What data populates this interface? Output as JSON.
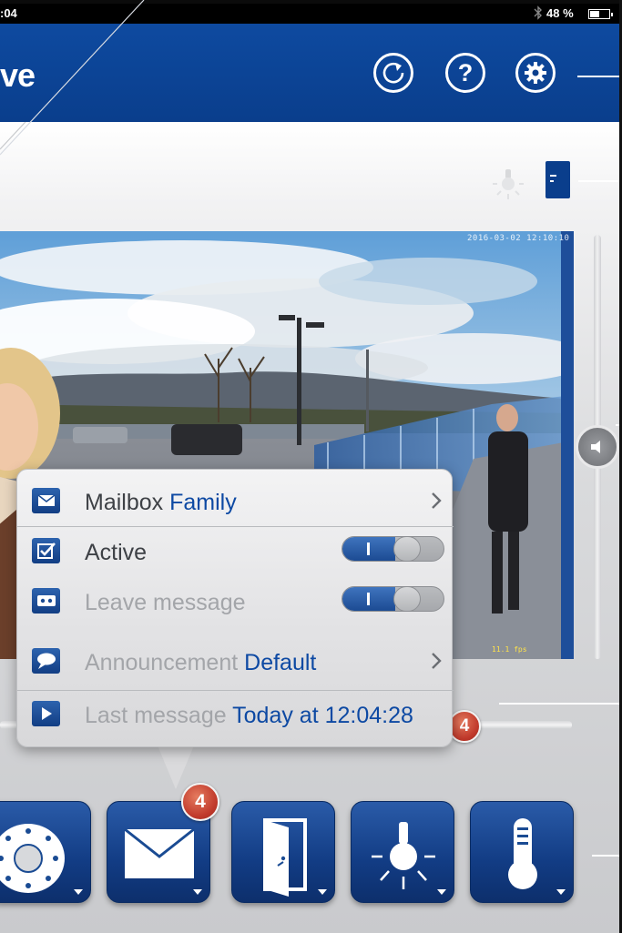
{
  "status_bar": {
    "time": ":04",
    "battery_text": "48 %",
    "battery_level_percent": 48
  },
  "header": {
    "brand_fragment": "ve",
    "buttons": [
      {
        "id": "refresh",
        "icon": "refresh-icon"
      },
      {
        "id": "help",
        "icon": "help-icon",
        "glyph": "?"
      },
      {
        "id": "settings",
        "icon": "gear-icon"
      }
    ],
    "color": "#0a3e8c"
  },
  "camera": {
    "timestamp": "2016-03-02 12:10:10",
    "overlay": "11.1 fps"
  },
  "mailbox_popup": {
    "rows": [
      {
        "label": "Mailbox",
        "value": "Family",
        "icon": "mail-icon",
        "chevron": true
      },
      {
        "label": "Active",
        "icon": "checkbox-icon",
        "toggle_on": true
      },
      {
        "label": "Leave message",
        "icon": "voicemail-icon",
        "toggle_on": true
      },
      {
        "label": "Announcement",
        "value": "Default",
        "icon": "speech-bubble-icon",
        "chevron": true
      },
      {
        "label": "Last message",
        "value": "Today at 12:04:28",
        "icon": "play-icon"
      }
    ]
  },
  "message_count": "4",
  "slider_badge": "4",
  "bottom_buttons": [
    {
      "id": "camera",
      "icon": "dome-camera-icon"
    },
    {
      "id": "mailbox",
      "icon": "envelope-icon",
      "badge": "4"
    },
    {
      "id": "door",
      "icon": "door-icon"
    },
    {
      "id": "light",
      "icon": "light-bulb-icon"
    },
    {
      "id": "temperature",
      "icon": "thermometer-icon"
    }
  ],
  "colors": {
    "accent_blue": "#0d49a3",
    "badge_red": "#c0392b"
  }
}
